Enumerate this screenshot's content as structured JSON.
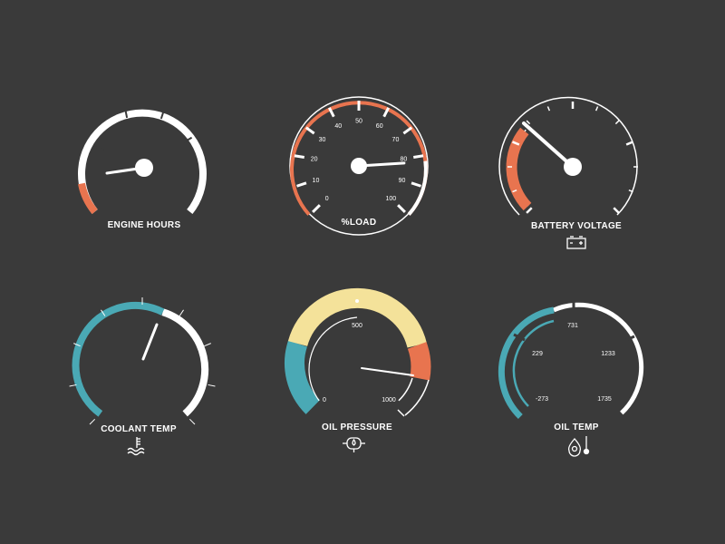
{
  "colors": {
    "background": "#3a3a3a",
    "white": "#ffffff",
    "orange": "#e8744f",
    "teal": "#4aa9b5",
    "yellow": "#f4e29a"
  },
  "gauges": {
    "engine_hours": {
      "label": "ENGINE HOURS",
      "needle_fraction": 0.1,
      "warning_zone": "low"
    },
    "load": {
      "label": "%LOAD",
      "scale_labels": [
        "0",
        "10",
        "20",
        "30",
        "40",
        "50",
        "60",
        "70",
        "80",
        "90",
        "100"
      ],
      "needle_value": 82
    },
    "battery_voltage": {
      "label": "BATTERY VOLTAGE",
      "icon": "battery-icon",
      "needle_fraction": 0.12
    },
    "coolant_temp": {
      "label": "COOLANT TEMP",
      "icon": "coolant-temperature-icon",
      "needle_fraction": 0.58
    },
    "oil_pressure": {
      "label": "OIL PRESSURE",
      "icon": "oil-pressure-icon",
      "scale_labels": [
        "0",
        "500",
        "1000"
      ],
      "needle_value": 870
    },
    "oil_temp": {
      "label": "OIL TEMP",
      "icon": "oil-temperature-icon",
      "scale_labels": [
        "-273",
        "229",
        "731",
        "1233",
        "1735"
      ],
      "level_fraction": 0.25
    }
  }
}
